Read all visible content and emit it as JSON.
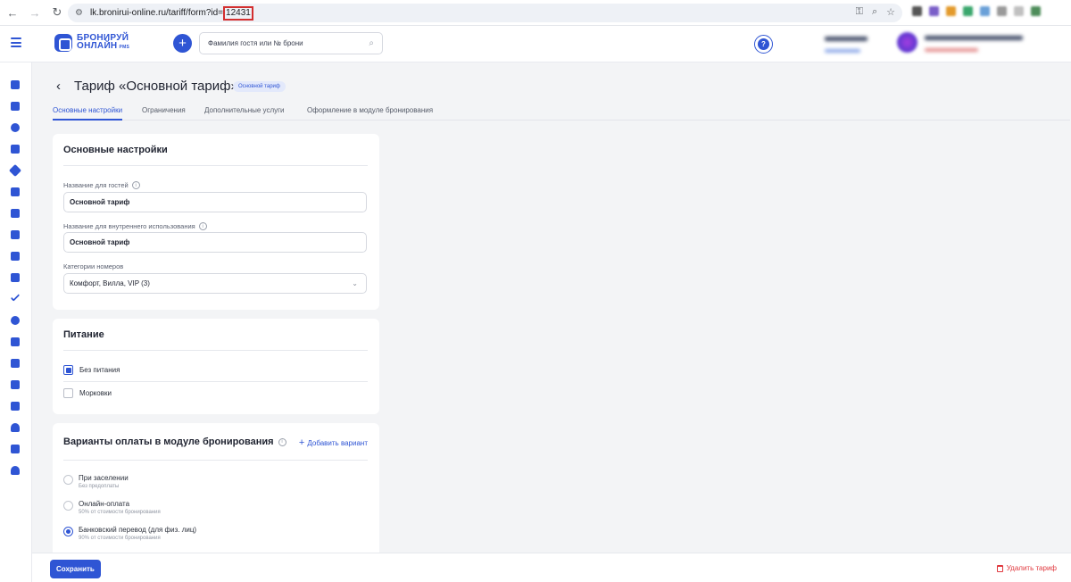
{
  "browser": {
    "url_prefix": "lk.bronirui-online.ru/tariff/form?id=",
    "url_id": "12431"
  },
  "header": {
    "logo_line1": "БРОНИРУЙ",
    "logo_line2": "ОНЛАЙН",
    "logo_sub": "PMS",
    "search_placeholder": "Фамилия гостя или № брони",
    "help_label": "?"
  },
  "page": {
    "title": "Тариф «Основной тариф»",
    "badge": "Основной тариф",
    "tabs": [
      {
        "label": "Основные настройки",
        "active": true
      },
      {
        "label": "Ограничения",
        "active": false
      },
      {
        "label": "Дополнительные услуги",
        "active": false
      },
      {
        "label": "Оформление в модуле бронирования",
        "active": false
      }
    ]
  },
  "basic": {
    "title": "Основные настройки",
    "guest_name_label": "Название для гостей",
    "guest_name_value": "Основной тариф",
    "internal_name_label": "Название для внутреннего использования",
    "internal_name_value": "Основной тариф",
    "categories_label": "Категории номеров",
    "categories_value": "Комфорт, Вилла, VIP (3)"
  },
  "meals": {
    "title": "Питание",
    "options": [
      {
        "label": "Без питания",
        "checked": true
      },
      {
        "label": "Морковки",
        "checked": false
      }
    ]
  },
  "payment": {
    "title": "Варианты оплаты в модуле бронирования",
    "add_label": "Добавить вариант",
    "options": [
      {
        "title": "При заселении",
        "subtitle": "Без предоплаты",
        "selected": false
      },
      {
        "title": "Онлайн-оплата",
        "subtitle": "50% от стоимости бронирования",
        "selected": false
      },
      {
        "title": "Банковский перевод (для физ. лиц)",
        "subtitle": "90% от стоимости бронирования",
        "selected": true
      }
    ]
  },
  "footer": {
    "save_label": "Сохранить",
    "delete_label": "Удалить тариф"
  },
  "colors": {
    "accent": "#2f55d4",
    "danger": "#e0383e"
  }
}
